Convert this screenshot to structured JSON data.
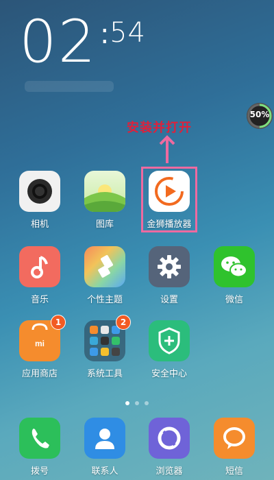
{
  "clock": {
    "hours": "02",
    "minutes": "54"
  },
  "battery": {
    "percent_label": "50%",
    "level": 50
  },
  "annotation": {
    "instruction": "安装并打开"
  },
  "apps": {
    "camera": {
      "label": "相机"
    },
    "gallery": {
      "label": "图库"
    },
    "jinshi_player": {
      "label": "金狮播放器"
    },
    "music": {
      "label": "音乐"
    },
    "themes": {
      "label": "个性主题"
    },
    "settings": {
      "label": "设置"
    },
    "wechat": {
      "label": "微信"
    },
    "app_store": {
      "label": "应用商店",
      "badge": "1"
    },
    "system_tools": {
      "label": "系统工具",
      "badge": "2"
    },
    "security_center": {
      "label": "安全中心"
    },
    "phone": {
      "label": "拨号"
    },
    "contacts": {
      "label": "联系人"
    },
    "browser": {
      "label": "浏览器"
    },
    "messages": {
      "label": "短信"
    }
  },
  "colors": {
    "annotation_red": "#e0203a",
    "highlight_pink": "#ee6aa0",
    "badge_orange": "#f25b23"
  }
}
